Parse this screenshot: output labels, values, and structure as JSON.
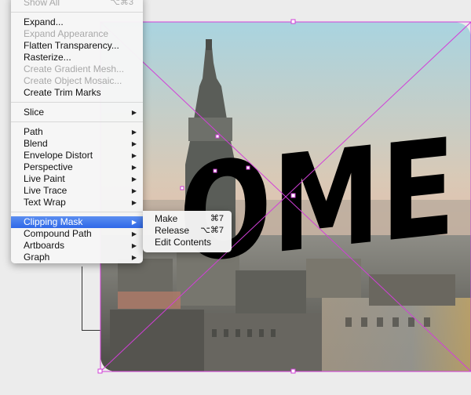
{
  "menu": {
    "items": [
      {
        "label": "Show All",
        "shortcut": "⌥⌘3",
        "disabled": true
      },
      {
        "separator": true
      },
      {
        "label": "Expand...",
        "disabled": false
      },
      {
        "label": "Expand Appearance",
        "disabled": true
      },
      {
        "label": "Flatten Transparency...",
        "disabled": false
      },
      {
        "label": "Rasterize...",
        "disabled": false
      },
      {
        "label": "Create Gradient Mesh...",
        "disabled": true
      },
      {
        "label": "Create Object Mosaic...",
        "disabled": true
      },
      {
        "label": "Create Trim Marks",
        "disabled": false
      },
      {
        "separator": true
      },
      {
        "label": "Slice",
        "submenu": true
      },
      {
        "separator": true
      },
      {
        "label": "Path",
        "submenu": true
      },
      {
        "label": "Blend",
        "submenu": true
      },
      {
        "label": "Envelope Distort",
        "submenu": true
      },
      {
        "label": "Perspective",
        "submenu": true
      },
      {
        "label": "Live Paint",
        "submenu": true
      },
      {
        "label": "Live Trace",
        "submenu": true
      },
      {
        "label": "Text Wrap",
        "submenu": true
      },
      {
        "separator": true
      },
      {
        "label": "Clipping Mask",
        "submenu": true,
        "highlighted": true
      },
      {
        "label": "Compound Path",
        "submenu": true
      },
      {
        "label": "Artboards",
        "submenu": true
      },
      {
        "label": "Graph",
        "submenu": true
      }
    ]
  },
  "submenu": {
    "items": [
      {
        "label": "Make",
        "shortcut": "⌘7"
      },
      {
        "label": "Release",
        "shortcut": "⌥⌘7"
      },
      {
        "label": "Edit Contents",
        "shortcut": ""
      }
    ]
  },
  "artwork": {
    "text": "OME",
    "selection_color": "#d23fd8",
    "text_color": "#000000"
  },
  "icons": {
    "submenu_arrow": "▶"
  }
}
